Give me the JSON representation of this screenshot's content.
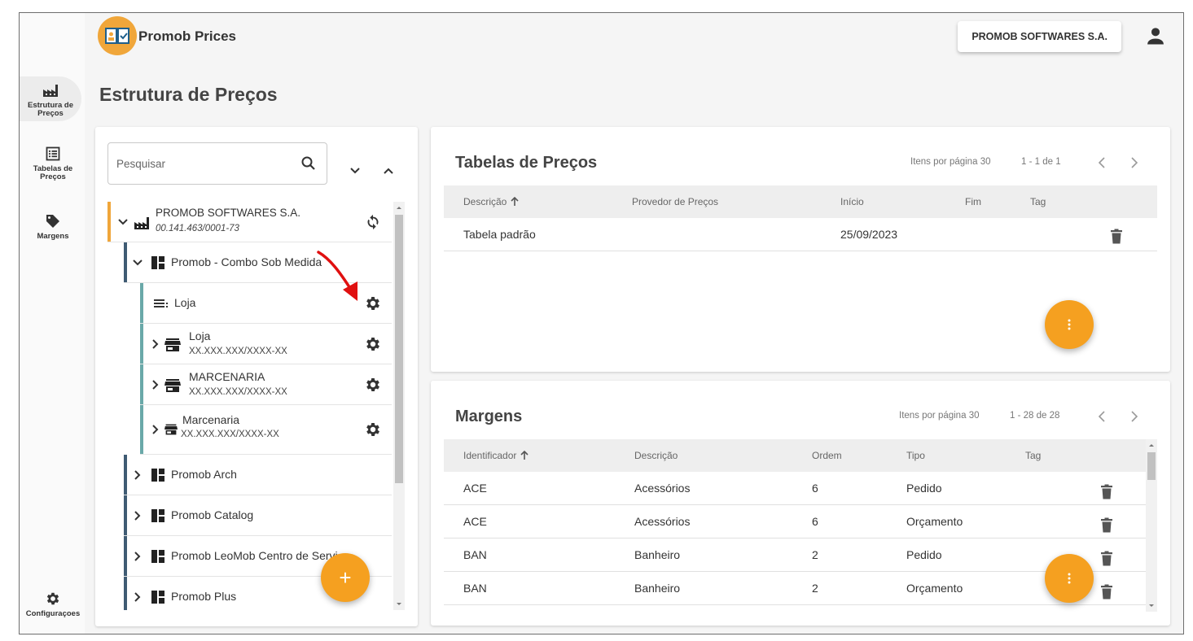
{
  "app": {
    "title": "Promob Prices",
    "company": "PROMOB SOFTWARES S.A."
  },
  "nav": {
    "items": [
      {
        "label": "Estrutura de Preços",
        "icon": "factory-icon",
        "active": true
      },
      {
        "label": "Tabelas de Preços",
        "icon": "list-icon",
        "active": false
      },
      {
        "label": "Margens",
        "icon": "tag-icon",
        "active": false
      }
    ],
    "settings": {
      "label": "Configuraçoes",
      "icon": "gear-icon"
    }
  },
  "page": {
    "title": "Estrutura de Preços"
  },
  "tree": {
    "search_placeholder": "Pesquisar",
    "root": {
      "name": "PROMOB SOFTWARES S.A.",
      "doc": "00.141.463/0001-73"
    },
    "combo": {
      "name": "Promob - Combo Sob Medida"
    },
    "combo_children": [
      {
        "name": "Loja",
        "doc": ""
      },
      {
        "name": "Loja",
        "doc": "XX.XXX.XXX/XXXX-XX"
      },
      {
        "name": "MARCENARIA",
        "doc": "XX.XXX.XXX/XXXX-XX"
      },
      {
        "name": "Marcenaria",
        "doc": "XX.XXX.XXX/XXXX-XX"
      }
    ],
    "products": [
      {
        "name": "Promob Arch"
      },
      {
        "name": "Promob Catalog"
      },
      {
        "name": "Promob LeoMob Centro de Servi"
      },
      {
        "name": "Promob Plus"
      }
    ],
    "fab_label": "+"
  },
  "tables": {
    "title": "Tabelas de Preços",
    "items_per_page_label": "Itens por página",
    "items_per_page": "30",
    "range": "1 - 1 de 1",
    "columns": [
      "Descrição",
      "Provedor de Preços",
      "Início",
      "Fim",
      "Tag"
    ],
    "rows": [
      {
        "descricao": "Tabela padrão",
        "provedor": "",
        "inicio": "25/09/2023",
        "fim": "",
        "tag": ""
      }
    ]
  },
  "margins": {
    "title": "Margens",
    "items_per_page_label": "Itens por página",
    "items_per_page": "30",
    "range": "1 - 28 de 28",
    "columns": [
      "Identificador",
      "Descrição",
      "Ordem",
      "Tipo",
      "Tag"
    ],
    "rows": [
      {
        "id": "ACE",
        "descricao": "Acessórios",
        "ordem": "6",
        "tipo": "Pedido"
      },
      {
        "id": "ACE",
        "descricao": "Acessórios",
        "ordem": "6",
        "tipo": "Orçamento"
      },
      {
        "id": "BAN",
        "descricao": "Banheiro",
        "ordem": "2",
        "tipo": "Pedido"
      },
      {
        "id": "BAN",
        "descricao": "Banheiro",
        "ordem": "2",
        "tipo": "Orçamento"
      }
    ]
  },
  "colors": {
    "accent": "#f5a020",
    "root_bar": "#f0a63a",
    "product_bar": "#3f5b73",
    "store_bar": "#6aa9a9",
    "annotation_arrow": "#e01010"
  }
}
